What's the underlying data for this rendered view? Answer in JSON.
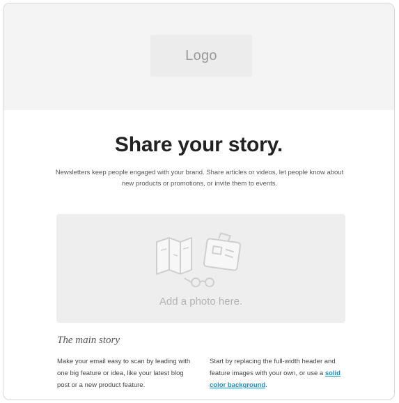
{
  "header": {
    "logo_text": "Logo"
  },
  "hero": {
    "headline": "Share your story.",
    "intro": "Newsletters keep people engaged with your brand. Share articles or videos, let people know about new products or promotions, or invite them to events."
  },
  "photo": {
    "label": "Add a photo here.",
    "icons": [
      "map-icon",
      "suitcase-icon",
      "glasses-icon"
    ]
  },
  "main_story": {
    "title": "The main story",
    "left_text": "Make your email easy to scan by leading with one big feature or idea, like your latest blog post or a new product feature.",
    "right_text_before": "Start by replacing the full-width header and feature images with your own, or use a ",
    "right_link": "solid color background",
    "right_text_after": "."
  },
  "colors": {
    "header_bg": "#f4f4f4",
    "link": "#1a91c9",
    "placeholder_bg": "#eeeeee"
  }
}
